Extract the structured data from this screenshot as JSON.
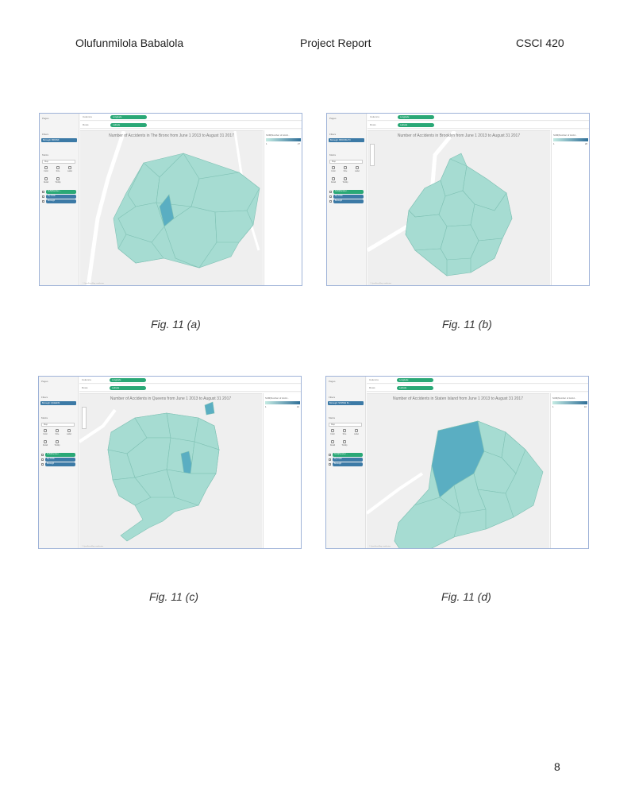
{
  "header": {
    "author": "Olufunmilola Babalola",
    "title": "Project Report",
    "course": "CSCI 420"
  },
  "tableau": {
    "pages_label": "Pages",
    "filters_label": "Filters",
    "marks_label": "Marks",
    "columns_label": "Columns",
    "rows_label": "Rows",
    "columns_pill": "Longitude",
    "rows_pill": "Latitude",
    "mark_type": "Map",
    "mark_buttons": [
      "Color",
      "Size",
      "Label",
      "Detail",
      "Tooltip"
    ],
    "mark_pills": [
      "SUM(Number ...",
      "Zip Code",
      "Borough"
    ],
    "legend_title": "SUM(Number of Accid...",
    "map_credit": "© OpenStreetMap contributors",
    "fill_color": "#a6dcd2",
    "stroke_color": "#7fc1b4",
    "highlight_color": "#5aaec2"
  },
  "figures": [
    {
      "caption": "Fig. 11 (a)",
      "map_title": "Number of Accidents in The Bronx from June 1 2013 to August 31 2017",
      "filter": "Borough: BRONX",
      "legend_min": "1",
      "legend_max": "27"
    },
    {
      "caption": "Fig. 11 (b)",
      "map_title": "Number of Accidents in Brooklyn from June 1 2013 to August 31 2017",
      "filter": "Borough: BROOKLYN",
      "legend_min": "1",
      "legend_max": "28"
    },
    {
      "caption": "Fig. 11 (c)",
      "map_title": "Number of Accidents in Queens from June 1 2013 to August 31 2017",
      "filter": "Borough: QUEENS",
      "legend_min": "1",
      "legend_max": "16"
    },
    {
      "caption": "Fig. 11 (d)",
      "map_title": "Number of Accidents in Staten Island from June 1 2013 to August 31 2017",
      "filter": "Borough: STATEN IS...",
      "legend_min": "1",
      "legend_max": "10"
    }
  ],
  "page_number": "8"
}
